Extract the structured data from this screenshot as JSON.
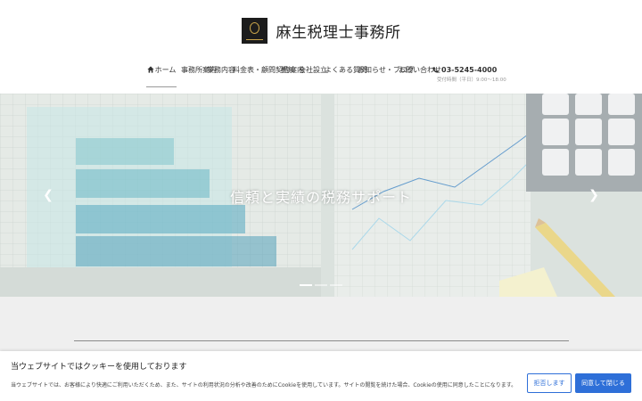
{
  "header": {
    "logo_alt": "firm logo",
    "firm_name": "麻生税理士事務所"
  },
  "nav": {
    "items": [
      {
        "label": "ホーム",
        "icon": "home-icon",
        "active": true
      },
      {
        "label": "事務所案内",
        "active": false
      },
      {
        "label": "業務内容",
        "active": false
      },
      {
        "label": "料金表・顧問契約案内",
        "active": false
      },
      {
        "label": "相続",
        "active": false
      },
      {
        "label": "会社設立",
        "active": false
      },
      {
        "label": "よくある質問",
        "active": false
      },
      {
        "label": "お知らせ・ブログ",
        "active": false
      },
      {
        "label": "お問い合わせ",
        "active": false
      }
    ],
    "phone": "03-5245-4000",
    "phone_icon": "phone-icon",
    "hours": "受付時間（平日）9:00～18:00"
  },
  "hero": {
    "caption": "信頼と実績の税務サポート",
    "prev_icon": "chevron-left-icon",
    "next_icon": "chevron-right-icon",
    "slide_count": 3,
    "active_slide": 0
  },
  "cookie_banner": {
    "title": "当ウェブサイトではクッキーを使用しております",
    "text": "当ウェブサイトでは、お客様により快適にご利用いただくため、また、サイトの利用状況の分析や改善のためにCookieを使用しています。サイトの閲覧を続けた場合、Cookieの使用に同意したことになります。",
    "reject_label": "拒否します",
    "accept_label": "同意して閉じる",
    "accent_color": "#2e6fd8"
  }
}
